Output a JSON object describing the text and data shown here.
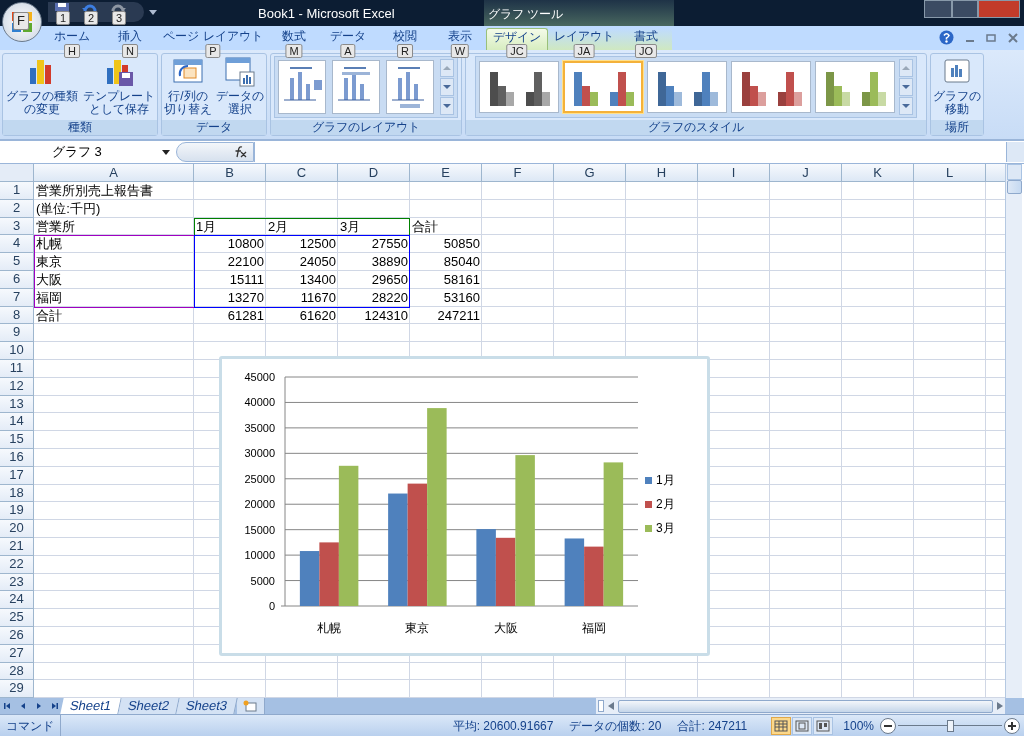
{
  "window": {
    "title": "Book1 - Microsoft Excel",
    "context_title": "グラフ ツール",
    "office_keytip": "F",
    "quick_access_keytips": [
      "1",
      "2",
      "3"
    ]
  },
  "tabs": [
    {
      "label": "ホーム",
      "keytip": "H",
      "selected": false,
      "contextual": false
    },
    {
      "label": "挿入",
      "keytip": "N",
      "selected": false,
      "contextual": false
    },
    {
      "label": "ページ レイアウト",
      "keytip": "P",
      "selected": false,
      "contextual": false
    },
    {
      "label": "数式",
      "keytip": "M",
      "selected": false,
      "contextual": false
    },
    {
      "label": "データ",
      "keytip": "A",
      "selected": false,
      "contextual": false
    },
    {
      "label": "校閲",
      "keytip": "R",
      "selected": false,
      "contextual": false
    },
    {
      "label": "表示",
      "keytip": "W",
      "selected": false,
      "contextual": false
    },
    {
      "label": "デザイン",
      "keytip": "JC",
      "selected": true,
      "contextual": true
    },
    {
      "label": "レイアウト",
      "keytip": "JA",
      "selected": false,
      "contextual": true
    },
    {
      "label": "書式",
      "keytip": "JO",
      "selected": false,
      "contextual": true
    }
  ],
  "ribbon": {
    "type_group": {
      "label": "種類",
      "buttons": [
        "グラフの種類の変更",
        "テンプレートとして保存"
      ]
    },
    "data_group": {
      "label": "データ",
      "buttons": [
        "行/列の切り替え",
        "データの選択"
      ]
    },
    "layout_group": {
      "label": "グラフのレイアウト",
      "layouts": [
        {
          "kind": "legend-right"
        },
        {
          "kind": "title-top"
        },
        {
          "kind": "legend-bottom"
        }
      ]
    },
    "style_group": {
      "label": "グラフのスタイル",
      "styles": [
        {
          "kind": "mono",
          "color": "#606060",
          "selected": false
        },
        {
          "kind": "multi",
          "selected": true
        },
        {
          "kind": "mono",
          "color": "#4f81bd",
          "selected": false
        },
        {
          "kind": "mono",
          "color": "#c0504d",
          "selected": false
        },
        {
          "kind": "mono",
          "color": "#9bbb59",
          "selected": false
        }
      ]
    },
    "location_group": {
      "label": "場所",
      "button": "グラフの移動"
    }
  },
  "formula_bar": {
    "name_box": "グラフ 3"
  },
  "sheet": {
    "columns": [
      "A",
      "B",
      "C",
      "D",
      "E",
      "F",
      "G",
      "H",
      "I",
      "J",
      "K",
      "L"
    ],
    "row_numbers": [
      "1",
      "2",
      "3",
      "4",
      "5",
      "6",
      "7",
      "8",
      "9",
      "10",
      "11",
      "12",
      "13",
      "14",
      "15",
      "16",
      "17",
      "18",
      "19",
      "20",
      "21",
      "22",
      "23",
      "24",
      "25",
      "26",
      "27",
      "28",
      "29"
    ],
    "rows": [
      {
        "kind": "title",
        "label": "営業所別売上報告書"
      },
      {
        "kind": "title",
        "label": "(単位:千円)"
      },
      {
        "kind": "header",
        "label": "営業所",
        "values": [
          "1月",
          "2月",
          "3月",
          "合計"
        ]
      },
      {
        "kind": "data",
        "label": "札幌",
        "values": [
          "10800",
          "12500",
          "27550",
          "50850"
        ]
      },
      {
        "kind": "data",
        "label": "東京",
        "values": [
          "22100",
          "24050",
          "38890",
          "85040"
        ]
      },
      {
        "kind": "data",
        "label": "大阪",
        "values": [
          "15111",
          "13400",
          "29650",
          "58161"
        ]
      },
      {
        "kind": "data",
        "label": "福岡",
        "values": [
          "13270",
          "11670",
          "28220",
          "53160"
        ]
      },
      {
        "kind": "data",
        "label": "合計",
        "values": [
          "61281",
          "61620",
          "124310",
          "247211"
        ]
      }
    ],
    "chart": {
      "chart_data": {
        "type": "bar",
        "categories": [
          "札幌",
          "東京",
          "大阪",
          "福岡"
        ],
        "series": [
          {
            "name": "1月",
            "color": "#4f81bd",
            "values": [
              10800,
              22100,
              15111,
              13270
            ]
          },
          {
            "name": "2月",
            "color": "#c0504d",
            "values": [
              12500,
              24050,
              13400,
              11670
            ]
          },
          {
            "name": "3月",
            "color": "#9bbb59",
            "values": [
              27550,
              38890,
              29650,
              28220
            ]
          }
        ],
        "ylim": [
          0,
          45000
        ],
        "yticks": [
          0,
          5000,
          10000,
          15000,
          20000,
          25000,
          30000,
          35000,
          40000,
          45000
        ],
        "grid": true,
        "legend": true
      }
    }
  },
  "sheet_tabs": [
    {
      "label": "Sheet1",
      "selected": true
    },
    {
      "label": "Sheet2",
      "selected": false
    },
    {
      "label": "Sheet3",
      "selected": false
    }
  ],
  "status_bar": {
    "mode": "コマンド",
    "stats": [
      "平均: 20600.91667",
      "データの個数: 20",
      "合計: 247211"
    ],
    "views": [
      {
        "kind": "normal",
        "selected": true
      },
      {
        "kind": "page-layout",
        "selected": false
      },
      {
        "kind": "page-break",
        "selected": false
      }
    ],
    "zoom": "100%",
    "zoom_level": {
      "level": 0.5
    }
  }
}
